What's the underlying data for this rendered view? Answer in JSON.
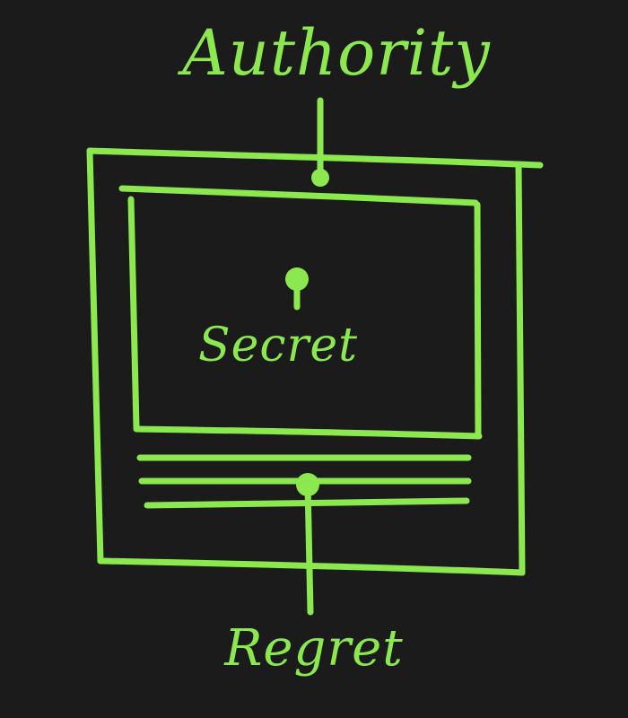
{
  "diagram": {
    "labels": {
      "top": "Authority",
      "middle": "Secret",
      "bottom": "Regret"
    },
    "colors": {
      "background": "#1b1b1b",
      "stroke": "#8be84f"
    }
  }
}
